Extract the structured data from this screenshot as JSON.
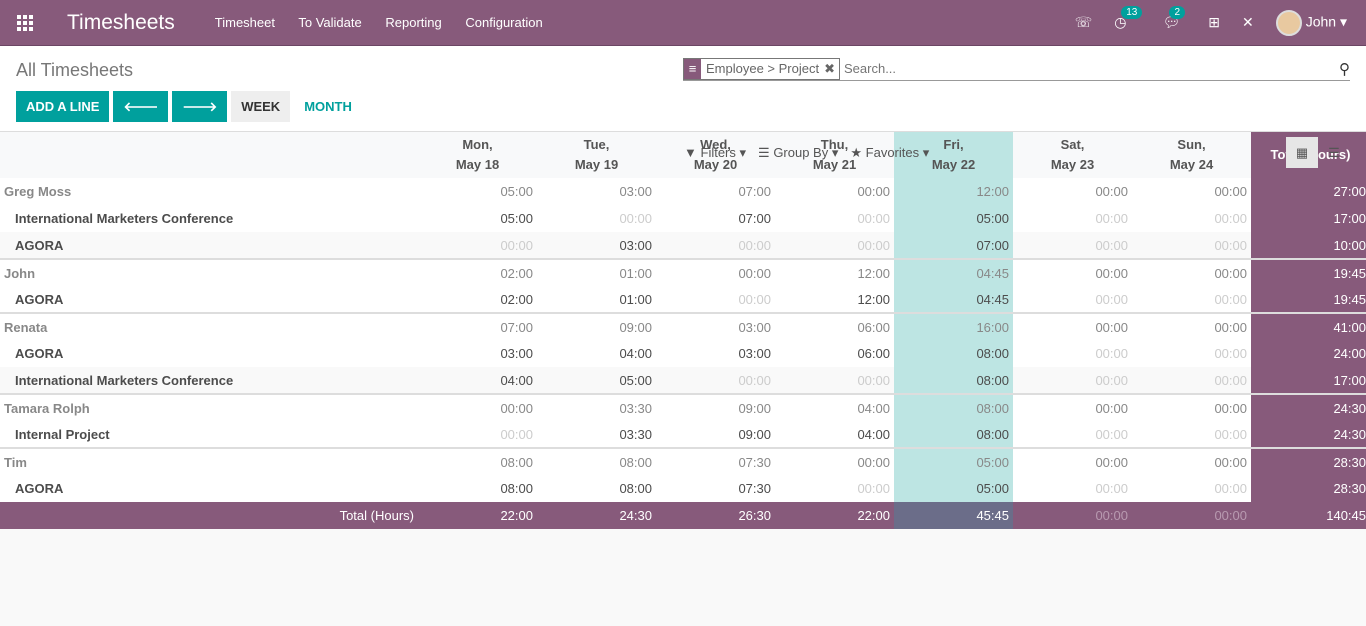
{
  "nav": {
    "app": "Timesheets",
    "menu": [
      "Timesheet",
      "To Validate",
      "Reporting",
      "Configuration"
    ],
    "activity_count": "13",
    "message_count": "2",
    "user": "John"
  },
  "page": {
    "title": "All Timesheets",
    "add_line": "ADD A LINE",
    "week": "WEEK",
    "month": "MONTH"
  },
  "search": {
    "facet": "Employee > Project",
    "placeholder": "Search...",
    "filters": "Filters",
    "group_by": "Group By",
    "favorites": "Favorites"
  },
  "colors": {
    "brand": "#875a7b",
    "accent": "#00a09d",
    "today": "#bde5e3"
  },
  "grid": {
    "columns": [
      [
        "Mon,",
        "May 18"
      ],
      [
        "Tue,",
        "May 19"
      ],
      [
        "Wed,",
        "May 20"
      ],
      [
        "Thu,",
        "May 21"
      ],
      [
        "Fri,",
        "May 22"
      ],
      [
        "Sat,",
        "May 23"
      ],
      [
        "Sun,",
        "May 24"
      ]
    ],
    "today_index": 4,
    "total_header": "Total (Hours)",
    "groups": [
      {
        "name": "Greg Moss",
        "values": [
          "05:00",
          "03:00",
          "07:00",
          "00:00",
          "12:00",
          "00:00",
          "00:00"
        ],
        "total": "27:00",
        "rows": [
          {
            "name": "International Marketers Conference",
            "values": [
              "05:00",
              "00:00",
              "07:00",
              "00:00",
              "05:00",
              "00:00",
              "00:00"
            ],
            "total": "17:00"
          },
          {
            "name": "AGORA",
            "values": [
              "00:00",
              "03:00",
              "00:00",
              "00:00",
              "07:00",
              "00:00",
              "00:00"
            ],
            "total": "10:00"
          }
        ]
      },
      {
        "name": "John",
        "values": [
          "02:00",
          "01:00",
          "00:00",
          "12:00",
          "04:45",
          "00:00",
          "00:00"
        ],
        "total": "19:45",
        "rows": [
          {
            "name": "AGORA",
            "values": [
              "02:00",
              "01:00",
              "00:00",
              "12:00",
              "04:45",
              "00:00",
              "00:00"
            ],
            "total": "19:45"
          }
        ]
      },
      {
        "name": "Renata",
        "values": [
          "07:00",
          "09:00",
          "03:00",
          "06:00",
          "16:00",
          "00:00",
          "00:00"
        ],
        "total": "41:00",
        "rows": [
          {
            "name": "AGORA",
            "values": [
              "03:00",
              "04:00",
              "03:00",
              "06:00",
              "08:00",
              "00:00",
              "00:00"
            ],
            "total": "24:00"
          },
          {
            "name": "International Marketers Conference",
            "values": [
              "04:00",
              "05:00",
              "00:00",
              "00:00",
              "08:00",
              "00:00",
              "00:00"
            ],
            "total": "17:00"
          }
        ]
      },
      {
        "name": "Tamara Rolph",
        "values": [
          "00:00",
          "03:30",
          "09:00",
          "04:00",
          "08:00",
          "00:00",
          "00:00"
        ],
        "total": "24:30",
        "rows": [
          {
            "name": "Internal Project",
            "values": [
              "00:00",
              "03:30",
              "09:00",
              "04:00",
              "08:00",
              "00:00",
              "00:00"
            ],
            "total": "24:30"
          }
        ]
      },
      {
        "name": "Tim",
        "values": [
          "08:00",
          "08:00",
          "07:30",
          "00:00",
          "05:00",
          "00:00",
          "00:00"
        ],
        "total": "28:30",
        "rows": [
          {
            "name": "AGORA",
            "values": [
              "08:00",
              "08:00",
              "07:30",
              "00:00",
              "05:00",
              "00:00",
              "00:00"
            ],
            "total": "28:30"
          }
        ]
      }
    ],
    "footer": {
      "label": "Total (Hours)",
      "values": [
        "22:00",
        "24:30",
        "26:30",
        "22:00",
        "45:45",
        "00:00",
        "00:00"
      ],
      "total": "140:45"
    }
  }
}
